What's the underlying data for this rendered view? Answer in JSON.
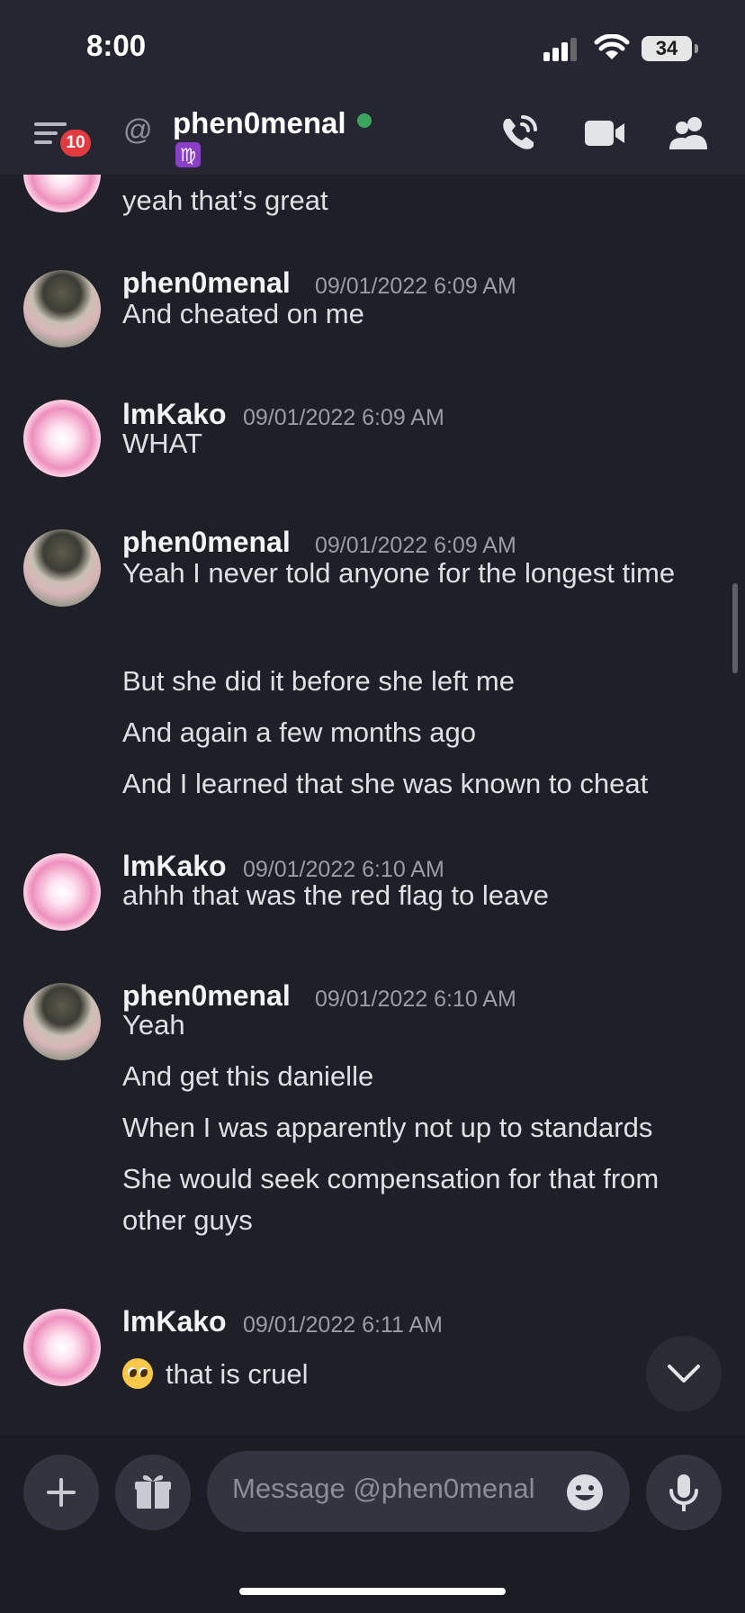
{
  "status_bar": {
    "time": "8:00",
    "battery": "34"
  },
  "header": {
    "unread_count": "10",
    "at_symbol": "@",
    "recipient": "phen0menal",
    "status_emoji": "♍"
  },
  "messages": [
    {
      "author": "",
      "timestamp": "",
      "lines": [
        "yeah that’s great"
      ],
      "avatar": "kako"
    },
    {
      "author": "phen0menal",
      "timestamp": "09/01/2022 6:09 AM",
      "lines": [
        "And cheated on me"
      ],
      "avatar": "phen"
    },
    {
      "author": "lmKako",
      "timestamp": "09/01/2022 6:09 AM",
      "lines": [
        "WHAT"
      ],
      "avatar": "kako"
    },
    {
      "author": "phen0menal",
      "timestamp": "09/01/2022 6:09 AM",
      "lines": [
        "Yeah I never told anyone for the longest time",
        "But she did it before she left me",
        "And again a few months ago",
        "And I learned that she was known to cheat"
      ],
      "avatar": "phen"
    },
    {
      "author": "lmKako",
      "timestamp": "09/01/2022 6:10 AM",
      "lines": [
        "ahhh that was the red flag to leave"
      ],
      "avatar": "kako"
    },
    {
      "author": "phen0menal",
      "timestamp": "09/01/2022 6:10 AM",
      "lines": [
        "Yeah",
        "And get this danielle",
        "When I was apparently not up to standards",
        "She would seek compensation for that from other guys"
      ],
      "avatar": "phen"
    },
    {
      "author": "lmKako",
      "timestamp": "09/01/2022 6:11 AM",
      "lines": [
        "that is cruel"
      ],
      "avatar": "kako",
      "emoji": "pleading-face"
    }
  ],
  "composer": {
    "placeholder": "Message @phen0menal"
  },
  "colors": {
    "background": "#1e1f27",
    "header": "#262632",
    "online": "#3ba55d",
    "badge": "#e23b3f"
  },
  "icons": [
    "hamburger-menu-icon",
    "at-icon",
    "call-icon",
    "video-icon",
    "members-icon",
    "plus-icon",
    "gift-icon",
    "emoji-icon",
    "microphone-icon",
    "chevron-down-icon"
  ]
}
